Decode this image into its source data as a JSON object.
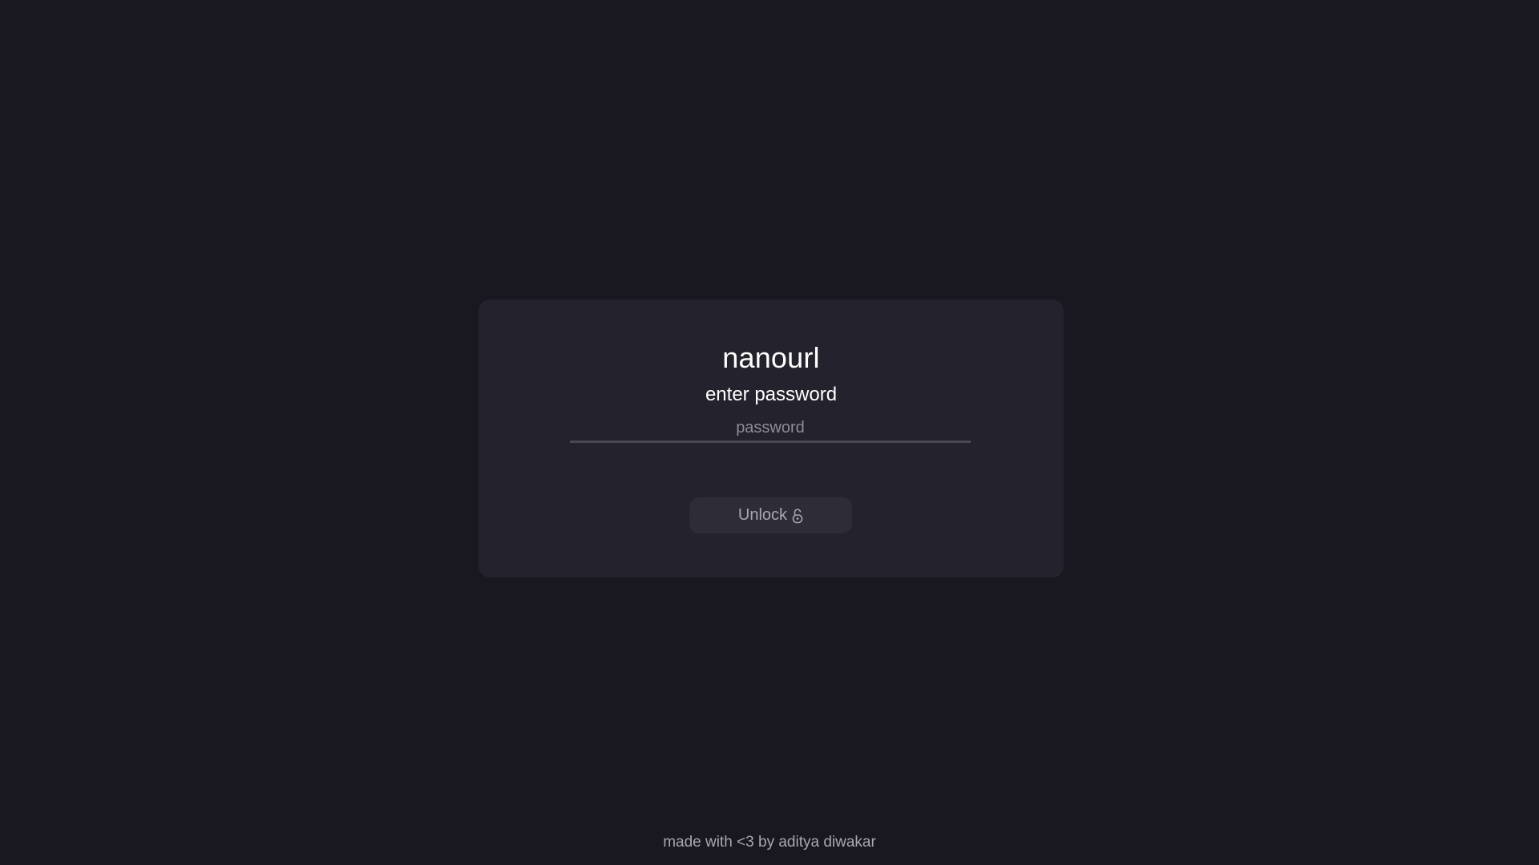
{
  "app": {
    "title": "nanourl",
    "subtitle": "enter password"
  },
  "form": {
    "password_placeholder": "password",
    "password_value": "",
    "unlock_label": "Unlock",
    "unlock_icon": "unlock-icon"
  },
  "footer": {
    "text": "made with <3 by aditya diwakar"
  },
  "colors": {
    "background": "#191821",
    "card": "#24232d",
    "button": "#2e2d37",
    "text_primary": "#ffffff",
    "text_muted": "#a8a7b0"
  }
}
